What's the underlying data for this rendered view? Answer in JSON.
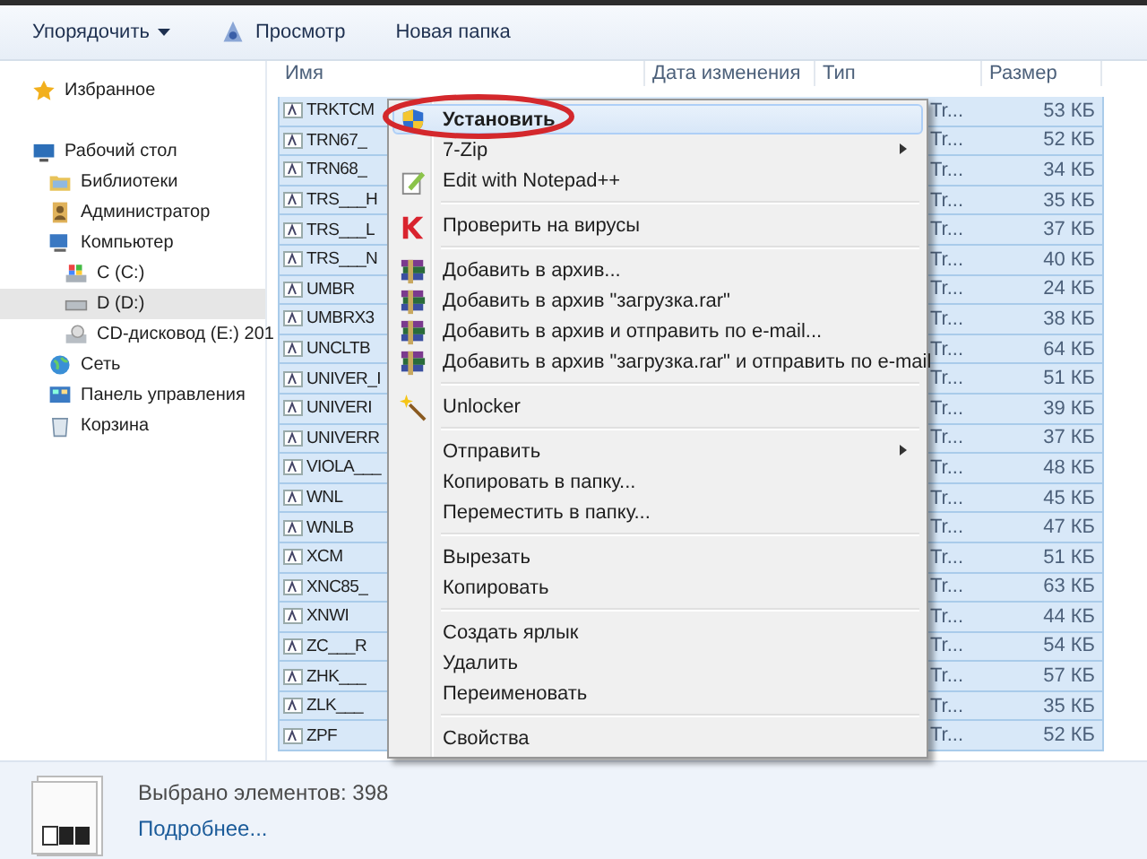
{
  "toolbar": {
    "buttons": [
      {
        "label": "Упорядочить",
        "kind": "dropdown"
      },
      {
        "label": "Просмотр",
        "kind": "preview"
      },
      {
        "label": "Новая папка",
        "kind": "plain"
      }
    ]
  },
  "sidebar": {
    "items": [
      {
        "label": "Избранное",
        "kind": "favorites",
        "selected": false
      },
      {
        "label": "Рабочий стол",
        "kind": "desktop",
        "selected": false,
        "children": [
          {
            "label": "Библиотеки",
            "kind": "libraries",
            "selected": false
          },
          {
            "label": "Администратор",
            "kind": "user",
            "selected": false
          },
          {
            "label": "Компьютер",
            "kind": "computer",
            "selected": false,
            "children": [
              {
                "label": "C (C:)",
                "kind": "system-drive",
                "selected": false
              },
              {
                "label": "D (D:)",
                "kind": "drive",
                "selected": true
              },
              {
                "label": "CD-дисковод (E:) 201",
                "kind": "cd-drive",
                "selected": false
              }
            ]
          },
          {
            "label": "Сеть",
            "kind": "network",
            "selected": false
          },
          {
            "label": "Панель управления",
            "kind": "control-panel",
            "selected": false
          },
          {
            "label": "Корзина",
            "kind": "trash",
            "selected": false
          }
        ]
      }
    ]
  },
  "table": {
    "columns": [
      "Имя",
      "Дата изменения",
      "Тип",
      "Размер"
    ],
    "rows": [
      {
        "name": "TRKTCM",
        "type": "Tr...",
        "size": "53 КБ",
        "selected": true
      },
      {
        "name": "TRN67_",
        "type": "Tr...",
        "size": "52 КБ",
        "selected": true
      },
      {
        "name": "TRN68_",
        "type": "Tr...",
        "size": "34 КБ",
        "selected": true
      },
      {
        "name": "TRS___H",
        "type": "Tr...",
        "size": "35 КБ",
        "selected": true
      },
      {
        "name": "TRS___L",
        "type": "Tr...",
        "size": "37 КБ",
        "selected": true
      },
      {
        "name": "TRS___N",
        "type": "Tr...",
        "size": "40 КБ",
        "selected": true
      },
      {
        "name": "UMBR",
        "type": "Tr...",
        "size": "24 КБ",
        "selected": true
      },
      {
        "name": "UMBRX3",
        "type": "Tr...",
        "size": "38 КБ",
        "selected": true
      },
      {
        "name": "UNCLTB",
        "type": "Tr...",
        "size": "64 КБ",
        "selected": true
      },
      {
        "name": "UNIVER_I",
        "type": "Tr...",
        "size": "51 КБ",
        "selected": true
      },
      {
        "name": "UNIVERI",
        "type": "Tr...",
        "size": "39 КБ",
        "selected": true
      },
      {
        "name": "UNIVERR",
        "type": "Tr...",
        "size": "37 КБ",
        "selected": true
      },
      {
        "name": "VIOLA___",
        "type": "Tr...",
        "size": "48 КБ",
        "selected": true
      },
      {
        "name": "WNL",
        "type": "Tr...",
        "size": "45 КБ",
        "selected": true
      },
      {
        "name": "WNLB",
        "type": "Tr...",
        "size": "47 КБ",
        "selected": true
      },
      {
        "name": "XCM",
        "type": "Tr...",
        "size": "51 КБ",
        "selected": true
      },
      {
        "name": "XNC85_",
        "type": "Tr...",
        "size": "63 КБ",
        "selected": true
      },
      {
        "name": "XNWI",
        "type": "Tr...",
        "size": "44 КБ",
        "selected": true
      },
      {
        "name": "ZC___R",
        "type": "Tr...",
        "size": "54 КБ",
        "selected": true
      },
      {
        "name": "ZHK___",
        "type": "Tr...",
        "size": "57 КБ",
        "selected": true
      },
      {
        "name": "ZLK___",
        "type": "Tr...",
        "size": "35 КБ",
        "selected": true
      },
      {
        "name": "ZPF",
        "type": "Tr...",
        "size": "52 КБ",
        "selected": true
      }
    ]
  },
  "context_menu": {
    "items": [
      {
        "kind": "install",
        "label": "Установить",
        "selected": true,
        "default": true
      },
      {
        "kind": "submenu",
        "label": "7-Zip",
        "selected": false,
        "default": false
      },
      {
        "kind": "edit",
        "label": "Edit with Notepad++",
        "selected": false,
        "default": false
      },
      {
        "kind": "separator"
      },
      {
        "kind": "scan",
        "label": "Проверить на вирусы",
        "selected": false,
        "default": false
      },
      {
        "kind": "separator"
      },
      {
        "kind": "archive",
        "label": "Добавить в архив...",
        "selected": false,
        "default": false
      },
      {
        "kind": "archive",
        "label": "Добавить в архив \"загрузка.rar\"",
        "selected": false,
        "default": false
      },
      {
        "kind": "archive",
        "label": "Добавить в архив и отправить по e-mail...",
        "selected": false,
        "default": false
      },
      {
        "kind": "archive",
        "label": "Добавить в архив \"загрузка.rar\" и отправить по e-mail",
        "selected": false,
        "default": false
      },
      {
        "kind": "separator"
      },
      {
        "kind": "unlock",
        "label": "Unlocker",
        "selected": false,
        "default": false
      },
      {
        "kind": "separator"
      },
      {
        "kind": "submenu",
        "label": "Отправить",
        "selected": false,
        "default": false
      },
      {
        "kind": "plain",
        "label": "Копировать в папку...",
        "selected": false,
        "default": false
      },
      {
        "kind": "plain",
        "label": "Переместить в папку...",
        "selected": false,
        "default": false
      },
      {
        "kind": "separator"
      },
      {
        "kind": "plain",
        "label": "Вырезать",
        "selected": false,
        "default": false
      },
      {
        "kind": "plain",
        "label": "Копировать",
        "selected": false,
        "default": false
      },
      {
        "kind": "separator"
      },
      {
        "kind": "plain",
        "label": "Создать ярлык",
        "selected": false,
        "default": false
      },
      {
        "kind": "plain",
        "label": "Удалить",
        "selected": false,
        "default": false
      },
      {
        "kind": "plain",
        "label": "Переименовать",
        "selected": false,
        "default": false
      },
      {
        "kind": "separator"
      },
      {
        "kind": "plain",
        "label": "Свойства",
        "selected": false,
        "default": false
      }
    ]
  },
  "status_bar": {
    "text": "Выбрано элементов: 398",
    "link": "Подробнее..."
  }
}
